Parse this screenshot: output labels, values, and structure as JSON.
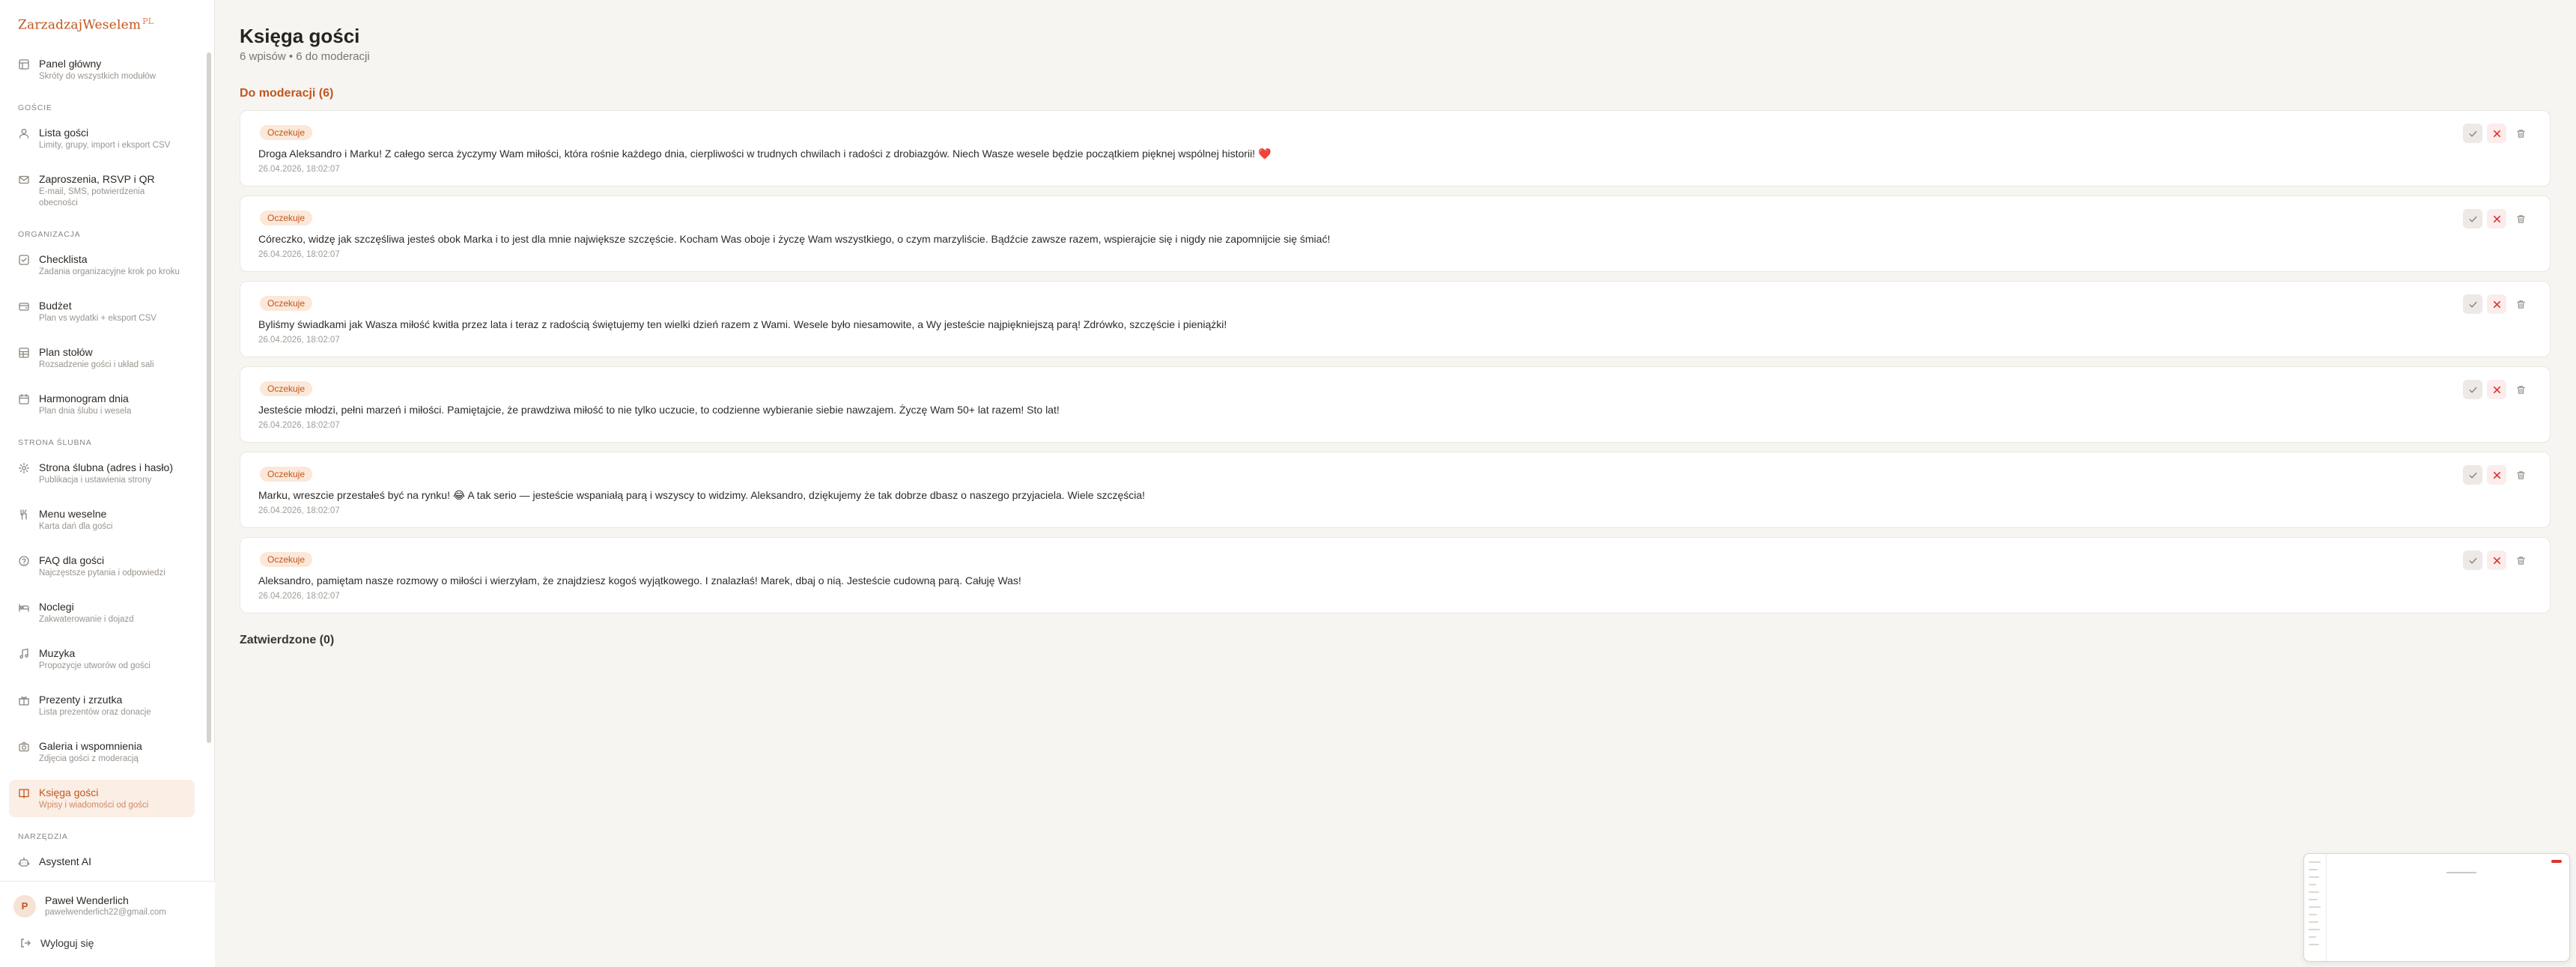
{
  "brand": {
    "name": "ZarzadzajWeselem",
    "suffix": "PL"
  },
  "sidebar": {
    "top_items": [
      {
        "title": "Panel główny",
        "sub": "Skróty do wszystkich modułów",
        "icon": "dashboard-icon"
      }
    ],
    "sections": [
      {
        "label": "GOŚCIE",
        "items": [
          {
            "title": "Lista gości",
            "sub": "Limity, grupy, import i eksport CSV",
            "icon": "user-icon"
          },
          {
            "title": "Zaproszenia, RSVP i QR",
            "sub": "E-mail, SMS, potwierdzenia obecności",
            "icon": "mail-icon"
          }
        ]
      },
      {
        "label": "ORGANIZACJA",
        "items": [
          {
            "title": "Checklista",
            "sub": "Zadania organizacyjne krok po kroku",
            "icon": "checkbox-icon"
          },
          {
            "title": "Budżet",
            "sub": "Plan vs wydatki + eksport CSV",
            "icon": "wallet-icon"
          },
          {
            "title": "Plan stołów",
            "sub": "Rozsadzenie gości i układ sali",
            "icon": "table-icon"
          },
          {
            "title": "Harmonogram dnia",
            "sub": "Plan dnia ślubu i wesela",
            "icon": "calendar-icon"
          }
        ]
      },
      {
        "label": "STRONA ŚLUBNA",
        "items": [
          {
            "title": "Strona ślubna (adres i hasło)",
            "sub": "Publikacja i ustawienia strony",
            "icon": "gear-icon"
          },
          {
            "title": "Menu weselne",
            "sub": "Karta dań dla gości",
            "icon": "utensils-icon"
          },
          {
            "title": "FAQ dla gości",
            "sub": "Najczęstsze pytania i odpowiedzi",
            "icon": "help-icon"
          },
          {
            "title": "Noclegi",
            "sub": "Zakwaterowanie i dojazd",
            "icon": "bed-icon"
          },
          {
            "title": "Muzyka",
            "sub": "Propozycje utworów od gości",
            "icon": "music-icon"
          },
          {
            "title": "Prezenty i zrzutka",
            "sub": "Lista prezentów oraz donacje",
            "icon": "gift-icon"
          },
          {
            "title": "Galeria i wspomnienia",
            "sub": "Zdjęcia gości z moderacją",
            "icon": "camera-icon"
          },
          {
            "title": "Księga gości",
            "sub": "Wpisy i wiadomości od gości",
            "icon": "book-icon",
            "active": true
          }
        ]
      },
      {
        "label": "NARZĘDZIA",
        "items": [
          {
            "title": "Asystent AI",
            "sub": "",
            "icon": "bot-icon"
          }
        ]
      }
    ],
    "user": {
      "initial": "P",
      "name": "Paweł Wenderlich",
      "email": "pawelwenderlich22@gmail.com"
    },
    "logout_label": "Wyloguj się"
  },
  "page": {
    "title": "Księga gości",
    "subtitle": "6 wpisów • 6 do moderacji",
    "pending_heading": "Do moderacji (6)",
    "approved_heading": "Zatwierdzone (0)"
  },
  "entries": [
    {
      "status": "Oczekuje",
      "text": "Droga Aleksandro i Marku! Z całego serca życzymy Wam miłości, która rośnie każdego dnia, cierpliwości w trudnych chwilach i radości z drobiazgów. Niech Wasze wesele będzie początkiem pięknej wspólnej historii! ❤️",
      "date": "26.04.2026, 18:02:07"
    },
    {
      "status": "Oczekuje",
      "text": "Córeczko, widzę jak szczęśliwa jesteś obok Marka i to jest dla mnie największe szczęście. Kocham Was oboje i życzę Wam wszystkiego, o czym marzyliście. Bądźcie zawsze razem, wspierajcie się i nigdy nie zapomnijcie się śmiać!",
      "date": "26.04.2026, 18:02:07"
    },
    {
      "status": "Oczekuje",
      "text": "Byliśmy świadkami jak Wasza miłość kwitła przez lata i teraz z radością świętujemy ten wielki dzień razem z Wami. Wesele było niesamowite, a Wy jesteście najpiękniejszą parą! Zdrówko, szczęście i pieniążki!",
      "date": "26.04.2026, 18:02:07"
    },
    {
      "status": "Oczekuje",
      "text": "Jesteście młodzi, pełni marzeń i miłości. Pamiętajcie, że prawdziwa miłość to nie tylko uczucie, to codzienne wybieranie siebie nawzajem. Życzę Wam 50+ lat razem! Sto lat!",
      "date": "26.04.2026, 18:02:07"
    },
    {
      "status": "Oczekuje",
      "text": "Marku, wreszcie przestałeś być na rynku! 😂 A tak serio — jesteście wspaniałą parą i wszyscy to widzimy. Aleksandro, dziękujemy że tak dobrze dbasz o naszego przyjaciela. Wiele szczęścia!",
      "date": "26.04.2026, 18:02:07"
    },
    {
      "status": "Oczekuje",
      "text": "Aleksandro, pamiętam nasze rozmowy o miłości i wierzyłam, że znajdziesz kogoś wyjątkowego. I znalazłaś! Marek, dbaj o nią. Jesteście cudowną parą. Całuję Was!",
      "date": "26.04.2026, 18:02:07"
    }
  ],
  "colors": {
    "accent": "#c2561e",
    "reject": "#d9362e",
    "background": "#f7f5f2"
  }
}
